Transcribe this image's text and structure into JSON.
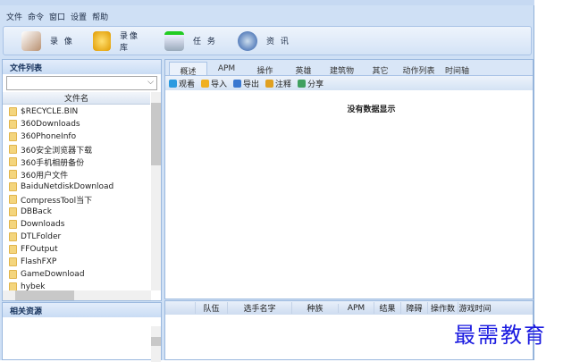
{
  "menu": [
    "文件",
    "命令",
    "窗口",
    "设置",
    "帮助"
  ],
  "toolbar": [
    {
      "label": "录 像",
      "icon": "video-icon"
    },
    {
      "label": "录像库",
      "icon": "box-icon"
    },
    {
      "label": "任 务",
      "icon": "drive-icon"
    },
    {
      "label": "资 讯",
      "icon": "globe-icon"
    }
  ],
  "file_list": {
    "title": "文件列表",
    "combo_value": "",
    "column": "文件名",
    "items": [
      "$RECYCLE.BIN",
      "360Downloads",
      "360PhoneInfo",
      "360安全浏览器下载",
      "360手机相册备份",
      "360用户文件",
      "BaiduNetdiskDownload",
      "CompressTool当下",
      "DBBack",
      "Downloads",
      "DTLFolder",
      "FFOutput",
      "FlashFXP",
      "GameDownload",
      "hybek"
    ]
  },
  "related": {
    "title": "相关资源"
  },
  "tabs": [
    "概述",
    "APM",
    "操作",
    "英雄",
    "建筑物",
    "其它",
    "动作列表",
    "时间轴"
  ],
  "active_tab": 0,
  "actions": [
    {
      "label": "观看",
      "color": "#2a9ae0"
    },
    {
      "label": "导入",
      "color": "#f0b020"
    },
    {
      "label": "导出",
      "color": "#3a78d0"
    },
    {
      "label": "注释",
      "color": "#e0a020"
    },
    {
      "label": "分享",
      "color": "#40a060"
    }
  ],
  "empty_message": "没有数据显示",
  "grid_columns": [
    "队伍",
    "选手名字",
    "种族",
    "APM",
    "结果",
    "障碍",
    "操作数",
    "游戏时间"
  ],
  "watermark": "最需教育"
}
